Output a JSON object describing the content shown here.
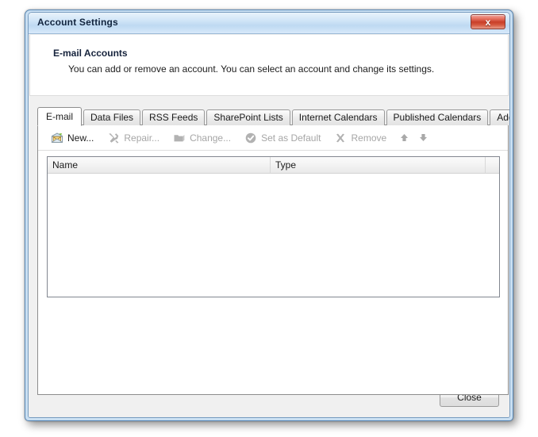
{
  "window": {
    "title": "Account Settings",
    "close_button": {
      "name": "close-button",
      "glyph": "x"
    }
  },
  "header": {
    "title": "E-mail Accounts",
    "subtitle": "You can add or remove an account. You can select an account and change its settings."
  },
  "tabs": [
    {
      "label": "E-mail",
      "active": true
    },
    {
      "label": "Data Files",
      "active": false
    },
    {
      "label": "RSS Feeds",
      "active": false
    },
    {
      "label": "SharePoint Lists",
      "active": false
    },
    {
      "label": "Internet Calendars",
      "active": false
    },
    {
      "label": "Published Calendars",
      "active": false
    },
    {
      "label": "Address Books",
      "active": false
    }
  ],
  "toolbar": {
    "items": [
      {
        "label": "New...",
        "icon": "new-mail-icon",
        "enabled": true
      },
      {
        "label": "Repair...",
        "icon": "repair-tools-icon",
        "enabled": false
      },
      {
        "label": "Change...",
        "icon": "change-folder-icon",
        "enabled": false
      },
      {
        "label": "Set as Default",
        "icon": "set-default-check-icon",
        "enabled": false
      },
      {
        "label": "Remove",
        "icon": "remove-x-icon",
        "enabled": false
      }
    ],
    "move_up": {
      "label": "↑",
      "name": "move-up-arrow-icon",
      "enabled": false
    },
    "move_down": {
      "label": "↓",
      "name": "move-down-arrow-icon",
      "enabled": false
    }
  },
  "accounts_list": {
    "columns": [
      "Name",
      "Type",
      ""
    ],
    "rows": []
  },
  "footer": {
    "close_label": "Close"
  },
  "colors": {
    "titlebar_top": "#e9f3fb",
    "titlebar_bottom": "#d7e9fa",
    "window_border": "#5a88b5",
    "close_red": "#c93f29",
    "client_bg": "#f0f0f0",
    "disabled_text": "#a6a6a6",
    "text": "#1b1b1b"
  }
}
